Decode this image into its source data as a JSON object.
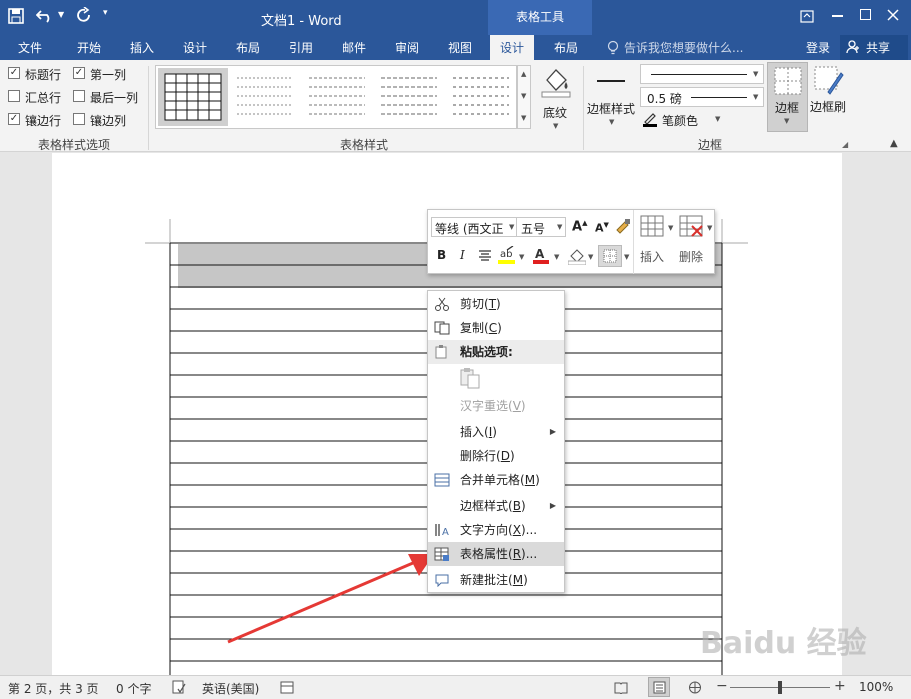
{
  "title_bar": {
    "doc_title": "文档1 - Word",
    "context_group": "表格工具",
    "qat": {
      "save_icon": "save-icon",
      "undo_icon": "undo-icon",
      "redo_icon": "redo-icon",
      "customize_icon": "customize-qat-icon"
    },
    "window_controls": [
      "ribbon-display-icon",
      "minimize-icon",
      "restore-icon",
      "close-icon"
    ]
  },
  "tabs": [
    {
      "label": "文件"
    },
    {
      "label": "开始"
    },
    {
      "label": "插入"
    },
    {
      "label": "设计"
    },
    {
      "label": "布局"
    },
    {
      "label": "引用"
    },
    {
      "label": "邮件"
    },
    {
      "label": "审阅"
    },
    {
      "label": "视图"
    },
    {
      "label": "设计",
      "active": true
    },
    {
      "label": "布局"
    }
  ],
  "tell_me": "告诉我您想要做什么...",
  "sign_in": "登录",
  "share": "共享",
  "ribbon": {
    "style_options": {
      "label": "表格样式选项",
      "checkboxes": [
        {
          "label": "标题行",
          "checked": true
        },
        {
          "label": "第一列",
          "checked": true
        },
        {
          "label": "汇总行",
          "checked": false
        },
        {
          "label": "最后一列",
          "checked": false
        },
        {
          "label": "镶边行",
          "checked": true
        },
        {
          "label": "镶边列",
          "checked": false
        }
      ]
    },
    "table_styles": {
      "label": "表格样式"
    },
    "shading": "底纹",
    "borders": {
      "label": "边框",
      "border_styles": "边框样式",
      "weight": "0.5 磅",
      "pen_color": "笔颜色",
      "borders_btn": "边框",
      "border_painter": "边框刷"
    }
  },
  "mini_toolbar": {
    "font": "等线 (西文正",
    "size": "五号",
    "bold": "B",
    "italic": "I",
    "insert": "插入",
    "delete": "删除",
    "font_color": "#e02020",
    "highlight_color": "#ffff00"
  },
  "context_menu": [
    {
      "label": "剪切",
      "key": "T",
      "icon": "scissors-icon"
    },
    {
      "label": "复制",
      "key": "C",
      "icon": "copy-icon"
    },
    {
      "label": "粘贴选项:",
      "header": true,
      "icon": "paste-icon"
    },
    {
      "label": "",
      "paste_icon": true
    },
    {
      "label": "汉字重选",
      "key": "V",
      "disabled": true
    },
    {
      "label": "插入",
      "key": "I",
      "submenu": true
    },
    {
      "label": "删除行",
      "key": "D"
    },
    {
      "label": "合并单元格",
      "key": "M",
      "icon": "merge-cells-icon"
    },
    {
      "label": "边框样式",
      "key": "B",
      "submenu": true
    },
    {
      "label": "文字方向",
      "key": "X",
      "suffix": "...",
      "icon": "text-direction-icon"
    },
    {
      "label": "表格属性",
      "key": "R",
      "suffix": "...",
      "icon": "table-properties-icon",
      "highlighted": true
    },
    {
      "label": "新建批注",
      "key": "M",
      "icon": "new-comment-icon"
    }
  ],
  "status_bar": {
    "page": "第 2 页，共 3 页",
    "words": "0 个字",
    "language": "英语(美国)",
    "zoom": "100%",
    "zoom_fraction": 0.5
  },
  "accent": "#2b579a",
  "arrow_color": "#e53935",
  "watermark": "Baidu 经验"
}
